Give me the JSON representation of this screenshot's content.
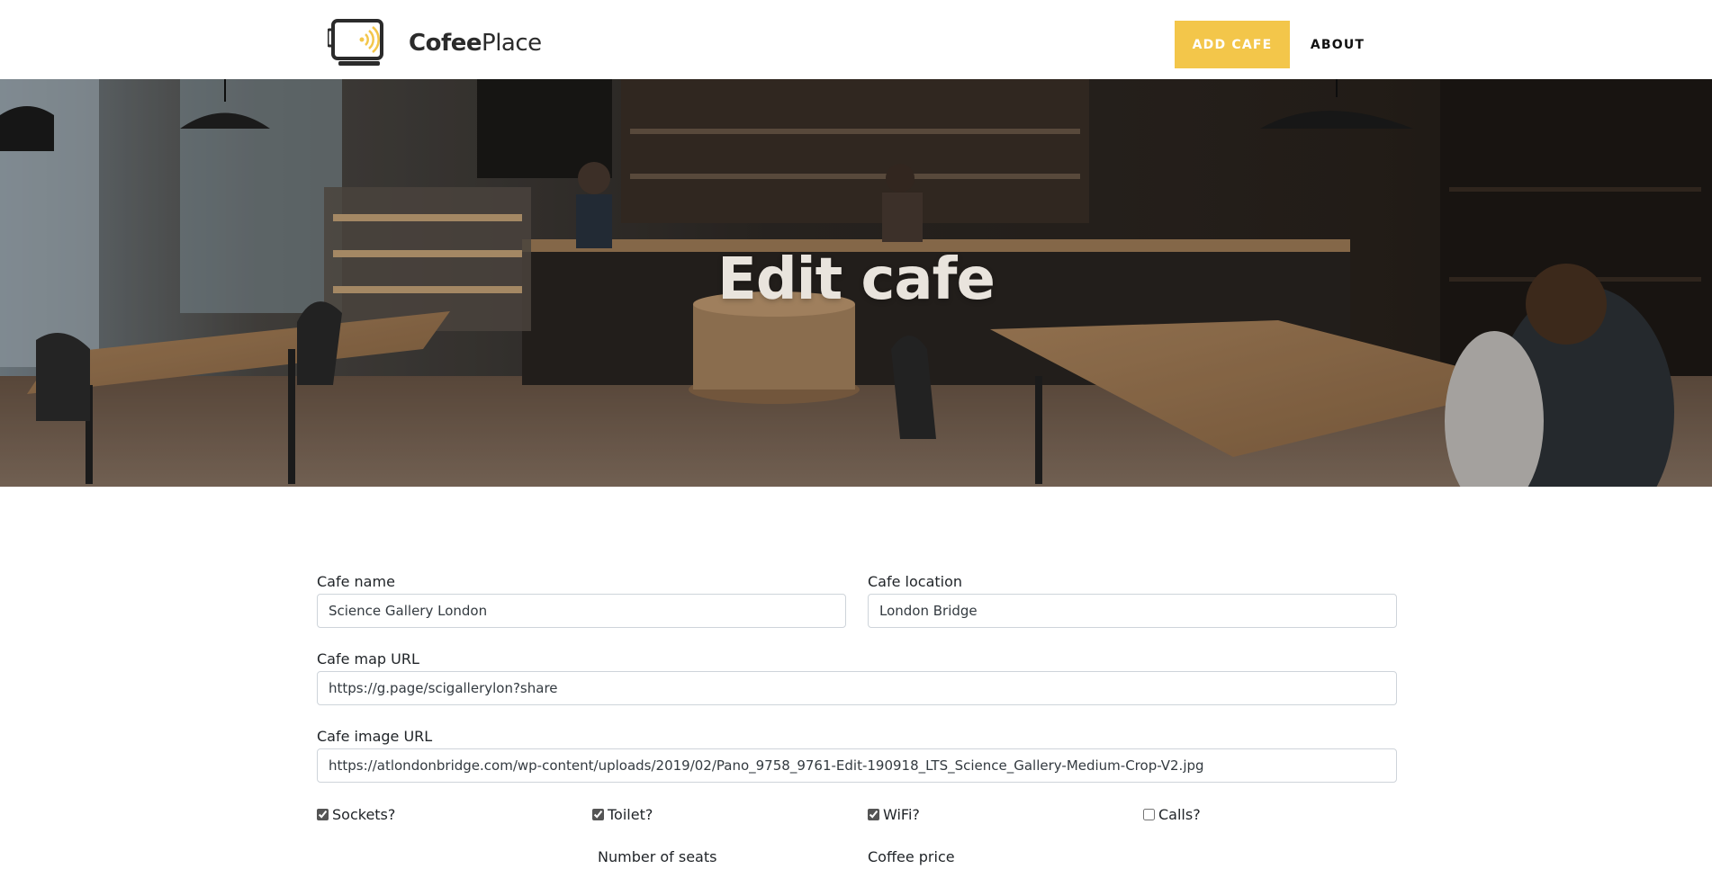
{
  "nav": {
    "brand_bold": "Cofee",
    "brand_light": "Place",
    "add_cafe_label": "ADD CAFE",
    "about_label": "ABOUT"
  },
  "hero": {
    "title": "Edit cafe"
  },
  "form": {
    "cafe_name": {
      "label": "Cafe name",
      "value": "Science Gallery London"
    },
    "cafe_location": {
      "label": "Cafe location",
      "value": "London Bridge"
    },
    "map_url": {
      "label": "Cafe map URL",
      "value": "https://g.page/scigallerylon?share"
    },
    "image_url": {
      "label": "Cafe image URL",
      "value": "https://atlondonbridge.com/wp-content/uploads/2019/02/Pano_9758_9761-Edit-190918_LTS_Science_Gallery-Medium-Crop-V2.jpg"
    },
    "sockets": {
      "label": "Sockets?",
      "checked": true
    },
    "toilet": {
      "label": "Toilet?",
      "checked": true
    },
    "wifi": {
      "label": "WiFi?",
      "checked": true
    },
    "calls": {
      "label": "Calls?",
      "checked": false
    },
    "seats": {
      "label": "Number of seats"
    },
    "price": {
      "label": "Coffee price"
    }
  },
  "colors": {
    "accent": "#f3c64a",
    "text": "#212529",
    "border": "#ced4da"
  },
  "icons": {
    "logo": "coffee-cup-wifi-icon"
  }
}
